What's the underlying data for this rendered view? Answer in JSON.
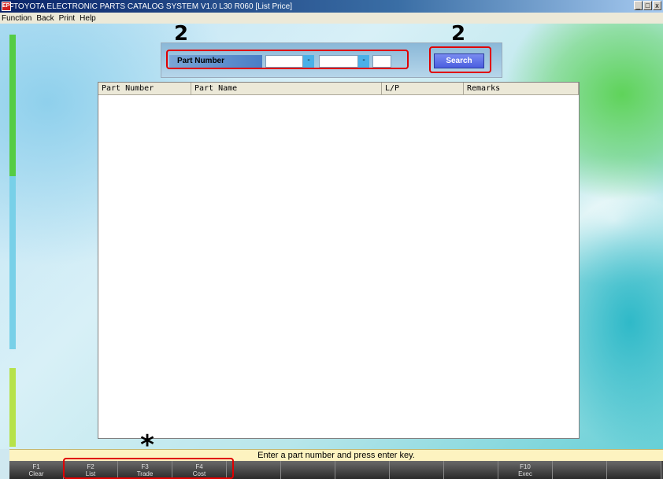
{
  "window": {
    "title": "TOYOTA ELECTRONIC PARTS CATALOG SYSTEM V1.0 L30 R060 [List Price]",
    "icon_text": "EPC",
    "controls": [
      "_",
      "□",
      "x"
    ]
  },
  "menu": [
    "Function",
    "Back",
    "Print",
    "Help"
  ],
  "search": {
    "label": "Part Number",
    "field1": "",
    "field2": "",
    "field3": "",
    "separator": "-",
    "button": "Search"
  },
  "table": {
    "columns": [
      "Part Number",
      "Part Name",
      "L/P",
      "Remarks"
    ],
    "rows": []
  },
  "status": "Enter a part number and press enter key.",
  "fkeys": [
    {
      "key": "F1",
      "label": "Clear"
    },
    {
      "key": "F2",
      "label": "List"
    },
    {
      "key": "F3",
      "label": "Trade"
    },
    {
      "key": "F4",
      "label": "Cost"
    },
    {
      "key": "",
      "label": ""
    },
    {
      "key": "",
      "label": ""
    },
    {
      "key": "",
      "label": ""
    },
    {
      "key": "",
      "label": ""
    },
    {
      "key": "",
      "label": ""
    },
    {
      "key": "F10",
      "label": "Exec"
    },
    {
      "key": "",
      "label": ""
    },
    {
      "key": "",
      "label": ""
    }
  ],
  "annotations": {
    "step_left": "2",
    "step_right": "2",
    "asterisk": "*"
  },
  "colors": {
    "callout": "#e00000",
    "search_button": "#5a6ee8"
  }
}
